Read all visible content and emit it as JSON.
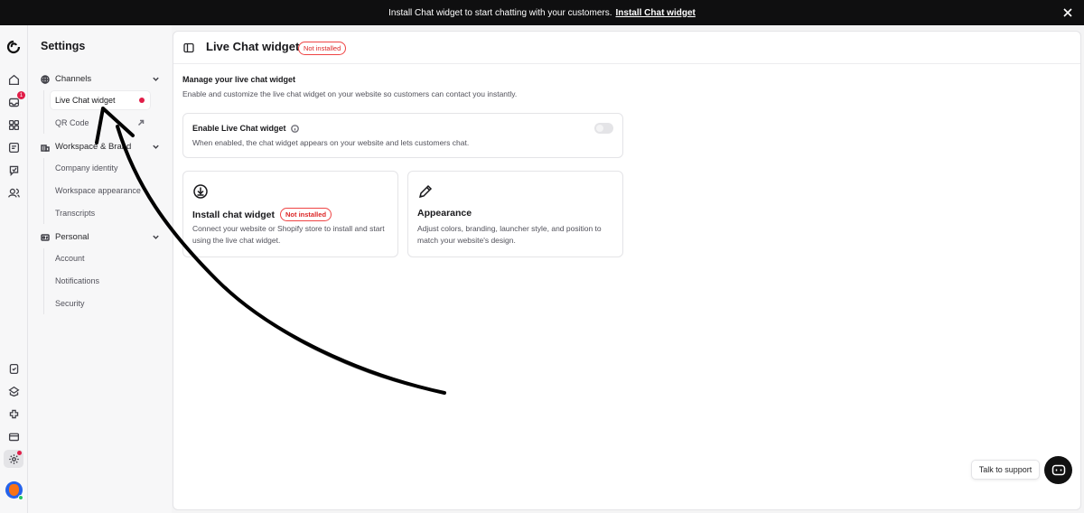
{
  "banner": {
    "text": "Install Chat widget to start chatting with your customers.",
    "link": "Install Chat widget"
  },
  "rail": {
    "inbox_count": "1"
  },
  "sidebar": {
    "title": "Settings",
    "groups": [
      {
        "label": "Channels",
        "icon": "channels-icon"
      },
      {
        "label": "Workspace & Brand",
        "icon": "workspace-icon"
      },
      {
        "label": "Personal",
        "icon": "personal-icon"
      }
    ],
    "channels": [
      "Live Chat widget",
      "QR Code"
    ],
    "workspace": [
      "Company identity",
      "Workspace appearance",
      "Transcripts"
    ],
    "personal": [
      "Account",
      "Notifications",
      "Security"
    ]
  },
  "main": {
    "title": "Live Chat widget",
    "status_badge": "Not installed",
    "section_title": "Manage your live chat widget",
    "section_desc": "Enable and customize the live chat widget on your website so customers can contact you instantly.",
    "enable_card": {
      "title": "Enable Live Chat widget",
      "desc": "When enabled, the chat widget appears on your website and lets customers chat.",
      "enabled": false
    },
    "install_card": {
      "title": "Install chat widget",
      "badge": "Not installed",
      "desc": "Connect your website or Shopify store to install and start using the live chat widget."
    },
    "appearance_card": {
      "title": "Appearance",
      "desc": "Adjust colors, branding, launcher style, and position to match your website's design."
    }
  },
  "support": {
    "label": "Talk to support"
  },
  "colors": {
    "accent_red": "#e11d48",
    "banner_bg": "#0f0f10"
  }
}
